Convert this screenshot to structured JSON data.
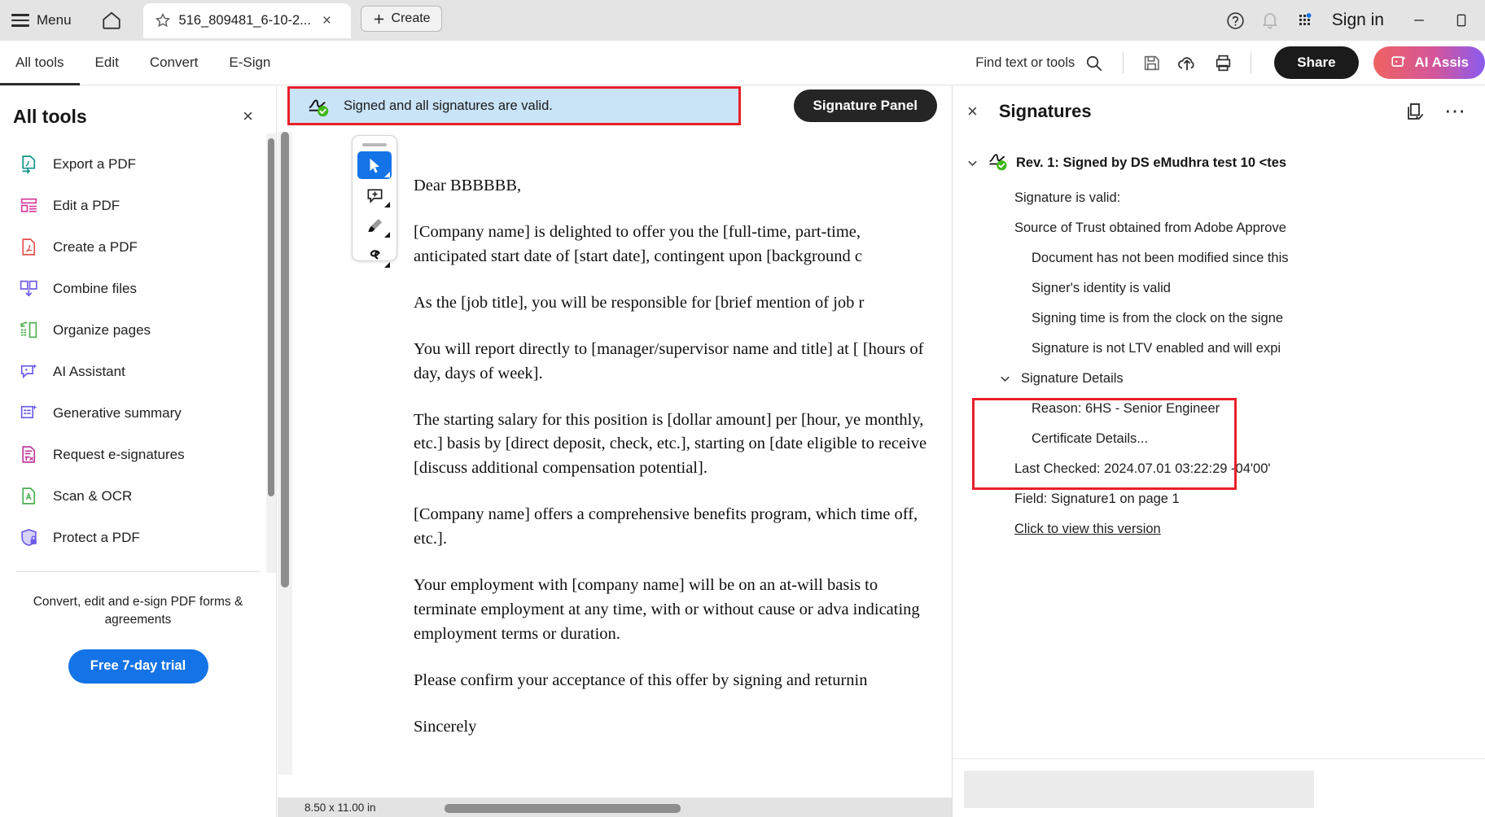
{
  "titlebar": {
    "menu_label": "Menu",
    "home_icon": "home-icon",
    "tab_title": "516_809481_6-10-2...",
    "tab_close": "×",
    "create_label": "Create",
    "signin_label": "Sign in",
    "help_icon": "help-icon",
    "bell_icon": "notification-bell-icon",
    "apps_icon": "app-grid-icon",
    "minimize_icon": "minimize-icon",
    "restore_icon": "restore-icon"
  },
  "menubar": {
    "tabs": [
      {
        "label": "All tools",
        "active": true
      },
      {
        "label": "Edit",
        "active": false
      },
      {
        "label": "Convert",
        "active": false
      },
      {
        "label": "E-Sign",
        "active": false
      }
    ],
    "find_label": "Find text or tools",
    "save_icon": "save-icon",
    "upload_icon": "cloud-upload-icon",
    "print_icon": "print-icon",
    "share_label": "Share",
    "ai_label": "AI Assis"
  },
  "sidebar": {
    "title": "All tools",
    "close": "×",
    "items": [
      {
        "label": "Export a PDF",
        "icon": "export-pdf-icon",
        "color": "#0d9488"
      },
      {
        "label": "Edit a PDF",
        "icon": "edit-pdf-icon",
        "color": "#d6399a"
      },
      {
        "label": "Create a PDF",
        "icon": "create-pdf-icon",
        "color": "#e34f4f"
      },
      {
        "label": "Combine files",
        "icon": "combine-files-icon",
        "color": "#6b5ce7"
      },
      {
        "label": "Organize pages",
        "icon": "organize-pages-icon",
        "color": "#4caf50"
      },
      {
        "label": "AI Assistant",
        "icon": "ai-assistant-icon",
        "color": "#6b5ce7"
      },
      {
        "label": "Generative summary",
        "icon": "generative-summary-icon",
        "color": "#6b5ce7"
      },
      {
        "label": "Request e-signatures",
        "icon": "request-esignatures-icon",
        "color": "#c0399a"
      },
      {
        "label": "Scan & OCR",
        "icon": "scan-ocr-icon",
        "color": "#4caf50"
      },
      {
        "label": "Protect a PDF",
        "icon": "protect-pdf-icon",
        "color": "#6b5ce7"
      }
    ],
    "promo_text": "Convert, edit and e-sign PDF forms & agreements",
    "trial_label": "Free 7-day trial"
  },
  "document": {
    "banner_text": "Signed and all signatures are valid.",
    "banner_icon": "signature-valid-icon",
    "signature_panel_button": "Signature Panel",
    "tools": [
      {
        "name": "select-tool",
        "icon": "cursor-icon",
        "active": true
      },
      {
        "name": "comment-tool",
        "icon": "add-comment-icon",
        "active": false
      },
      {
        "name": "highlight-tool",
        "icon": "highlighter-icon",
        "active": false
      },
      {
        "name": "draw-tool",
        "icon": "signature-draw-icon",
        "active": false
      }
    ],
    "paragraphs": [
      "Dear BBBBBB,",
      "[Company name] is delighted to offer you the [full-time, part-time, anticipated start date of [start date], contingent upon [background c",
      "As the [job title], you will be responsible for [brief mention of job r",
      "You will report directly to [manager/supervisor name and title] at [ [hours of day, days of week].",
      "The starting salary for this position is [dollar amount] per [hour, ye monthly, etc.] basis by [direct deposit, check, etc.], starting on [date eligible to receive [discuss additional compensation potential].",
      "[Company name] offers a comprehensive benefits program, which time off, etc.].",
      "Your employment with [company name] will be on an at-will basis to terminate employment at any time, with or without cause or adva indicating employment terms or duration.",
      "Please confirm your acceptance of this offer by signing and returnin",
      "Sincerely"
    ],
    "status_dimensions": "8.50 x 11.00 in"
  },
  "signatures": {
    "close": "×",
    "title": "Signatures",
    "validate_icon": "validate-all-icon",
    "more_icon": "more-options-icon",
    "revision": "Rev. 1: Signed by DS eMudhra test 10 <tes",
    "revision_icon": "signature-valid-icon",
    "rows": [
      {
        "text": "Signature is valid:",
        "indent": 0
      },
      {
        "text": "Source of Trust obtained from Adobe Approve",
        "indent": 0
      },
      {
        "text": "Document has not been modified since this",
        "indent": 1
      },
      {
        "text": "Signer's identity is valid",
        "indent": 1
      },
      {
        "text": "Signing time is from the clock on the signe",
        "indent": 1
      },
      {
        "text": "Signature is not LTV enabled and will expi",
        "indent": 1
      }
    ],
    "details_label": "Signature Details",
    "detail_rows": [
      "Reason: 6HS - Senior Engineer",
      "Certificate Details..."
    ],
    "last_checked": "Last Checked: 2024.07.01 03:22:29 -04'00'",
    "field": "Field: Signature1 on page 1",
    "view_version_link": "Click to view this version"
  },
  "colors": {
    "accent_blue": "#1473e6",
    "highlight_red": "#e8202a",
    "banner_blue": "#c9e3f7",
    "dark_button": "#1b1b1b"
  }
}
